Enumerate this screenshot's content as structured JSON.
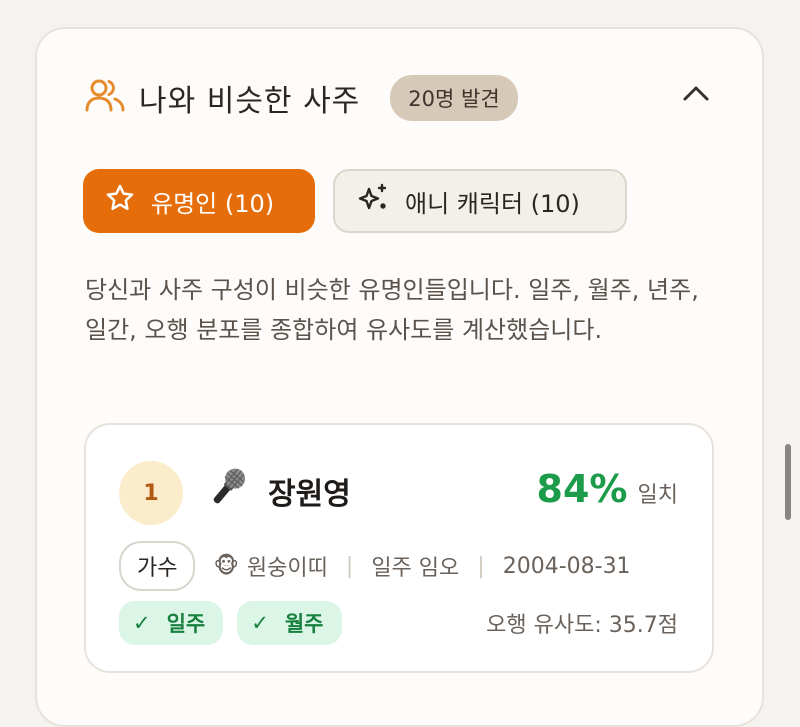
{
  "header": {
    "icon": "people-icon",
    "title": "나와 비슷한 사주",
    "found_badge": "20명 발견",
    "collapse_icon": "chevron-up-icon"
  },
  "tabs": [
    {
      "label": "유명인 (10)",
      "icon": "star-icon",
      "active": true
    },
    {
      "label": "애니 캐릭터 (10)",
      "icon": "sparkles-icon",
      "active": false
    }
  ],
  "description": "당신과 사주 구성이 비슷한 유명인들입니다. 일주, 월주, 년주, 일간, 오행 분포를 종합하여 유사도를 계산했습니다.",
  "results": [
    {
      "rank": "1",
      "icon": "microphone-icon",
      "name": "장원영",
      "match_percent": "84%",
      "match_label": "일치",
      "job": "가수",
      "zodiac_emoji": "🐵",
      "zodiac": "원숭이띠",
      "day_pillar": "일주 임오",
      "birth_date": "2004-08-31",
      "match_chips": [
        "일주",
        "월주"
      ],
      "five_elements_similarity": "오행 유사도: 35.7점"
    }
  ],
  "colors": {
    "accent": "#e66e0a",
    "badge_bg": "#d7c9b7",
    "match_green": "#1c9c4a",
    "chip_bg": "#dbf5e6"
  }
}
